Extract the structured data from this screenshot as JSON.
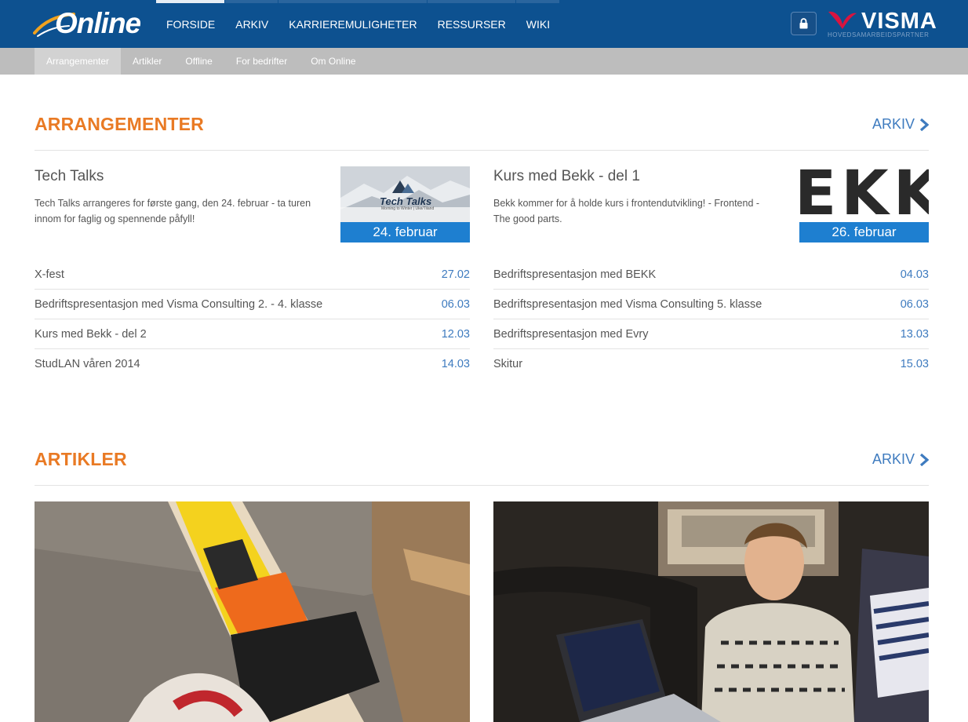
{
  "brand": {
    "logo_text": "Online"
  },
  "main_nav": [
    {
      "label": "FORSIDE",
      "active": true
    },
    {
      "label": "ARKIV"
    },
    {
      "label": "KARRIEREMULIGHETER"
    },
    {
      "label": "RESSURSER"
    },
    {
      "label": "WIKI"
    }
  ],
  "partner": {
    "name": "VISMA",
    "subtitle": "HOVEDSAMARBEIDSPARTNER"
  },
  "sub_nav": [
    {
      "label": "Arrangementer",
      "active": true
    },
    {
      "label": "Artikler"
    },
    {
      "label": "Offline"
    },
    {
      "label": "For bedrifter"
    },
    {
      "label": "Om Online"
    }
  ],
  "events_section": {
    "title": "ARRANGEMENTER",
    "archive_label": "ARKIV",
    "featured": [
      {
        "title": "Tech Talks",
        "description": "Tech Talks arrangeres for første gang, den 24. februar - ta turen innom for faglig og spennende påfyll!",
        "date_label": "24. februar",
        "thumb_title": "Tech Talks",
        "thumb_tagline": "Morning to Winter | Uke/Tiland"
      },
      {
        "title": "Kurs med Bekk - del 1",
        "description": "Bekk kommer for å holde kurs i frontendutvikling! - Frontend - The good parts.",
        "date_label": "26. februar",
        "thumb_title": "EKK"
      }
    ],
    "list_left": [
      {
        "name": "X-fest",
        "date": "27.02"
      },
      {
        "name": "Bedriftspresentasjon med Visma Consulting 2. - 4. klasse",
        "date": "06.03"
      },
      {
        "name": "Kurs med Bekk - del 2",
        "date": "12.03"
      },
      {
        "name": "StudLAN våren 2014",
        "date": "14.03"
      }
    ],
    "list_right": [
      {
        "name": "Bedriftspresentasjon med BEKK",
        "date": "04.03"
      },
      {
        "name": "Bedriftspresentasjon med Visma Consulting 5. klasse",
        "date": "06.03"
      },
      {
        "name": "Bedriftspresentasjon med Evry",
        "date": "13.03"
      },
      {
        "name": "Skitur",
        "date": "15.03"
      }
    ]
  },
  "articles_section": {
    "title": "ARTIKLER",
    "archive_label": "ARKIV"
  },
  "colors": {
    "navbar": "#0d5190",
    "subnav": "#bdbdbd",
    "section_title": "#e97a24",
    "link": "#3e7bbf",
    "date_badge": "#1e7fd0"
  }
}
